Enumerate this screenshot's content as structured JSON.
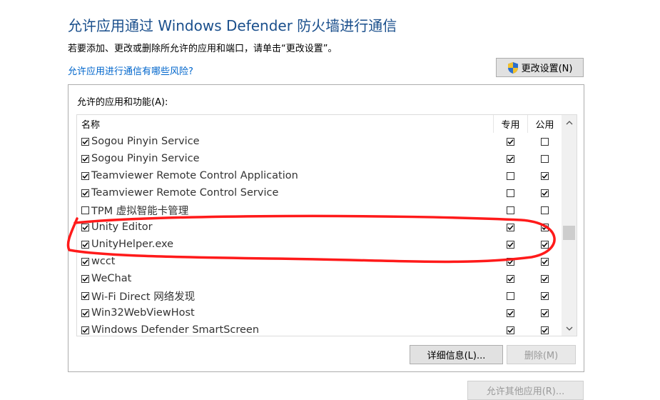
{
  "header": {
    "title": "允许应用通过 Windows Defender 防火墙进行通信",
    "subtitle": "若要添加、更改或删除所允许的应用和端口，请单击“更改设置”。",
    "risk_link": "允许应用进行通信有哪些风险?",
    "change_settings_label": "更改设置(N)"
  },
  "group": {
    "label": "允许的应用和功能(A):",
    "columns": {
      "name": "名称",
      "private": "专用",
      "public": "公用"
    },
    "rows": [
      {
        "name": "Sogou Pinyin Service",
        "enabled": true,
        "private": true,
        "public": false
      },
      {
        "name": "Sogou Pinyin Service",
        "enabled": true,
        "private": true,
        "public": false
      },
      {
        "name": "Teamviewer Remote Control Application",
        "enabled": true,
        "private": false,
        "public": true
      },
      {
        "name": "Teamviewer Remote Control Service",
        "enabled": true,
        "private": false,
        "public": true
      },
      {
        "name": "TPM 虚拟智能卡管理",
        "enabled": false,
        "private": false,
        "public": false
      },
      {
        "name": "Unity Editor",
        "enabled": true,
        "private": true,
        "public": true
      },
      {
        "name": "UnityHelper.exe",
        "enabled": true,
        "private": true,
        "public": true
      },
      {
        "name": "wcct",
        "enabled": true,
        "private": true,
        "public": true
      },
      {
        "name": "WeChat",
        "enabled": true,
        "private": true,
        "public": true
      },
      {
        "name": "Wi-Fi Direct 网络发现",
        "enabled": true,
        "private": false,
        "public": true
      },
      {
        "name": "Win32WebViewHost",
        "enabled": true,
        "private": true,
        "public": true
      },
      {
        "name": "Windows Defender SmartScreen",
        "enabled": true,
        "private": true,
        "public": true
      }
    ],
    "details_label": "详细信息(L)...",
    "delete_label": "删除(M)"
  },
  "footer": {
    "allow_other_label": "允许其他应用(R)..."
  },
  "colors": {
    "title": "#1a4f8c",
    "link": "#0066cc",
    "annotation": "#ff1a1a"
  }
}
